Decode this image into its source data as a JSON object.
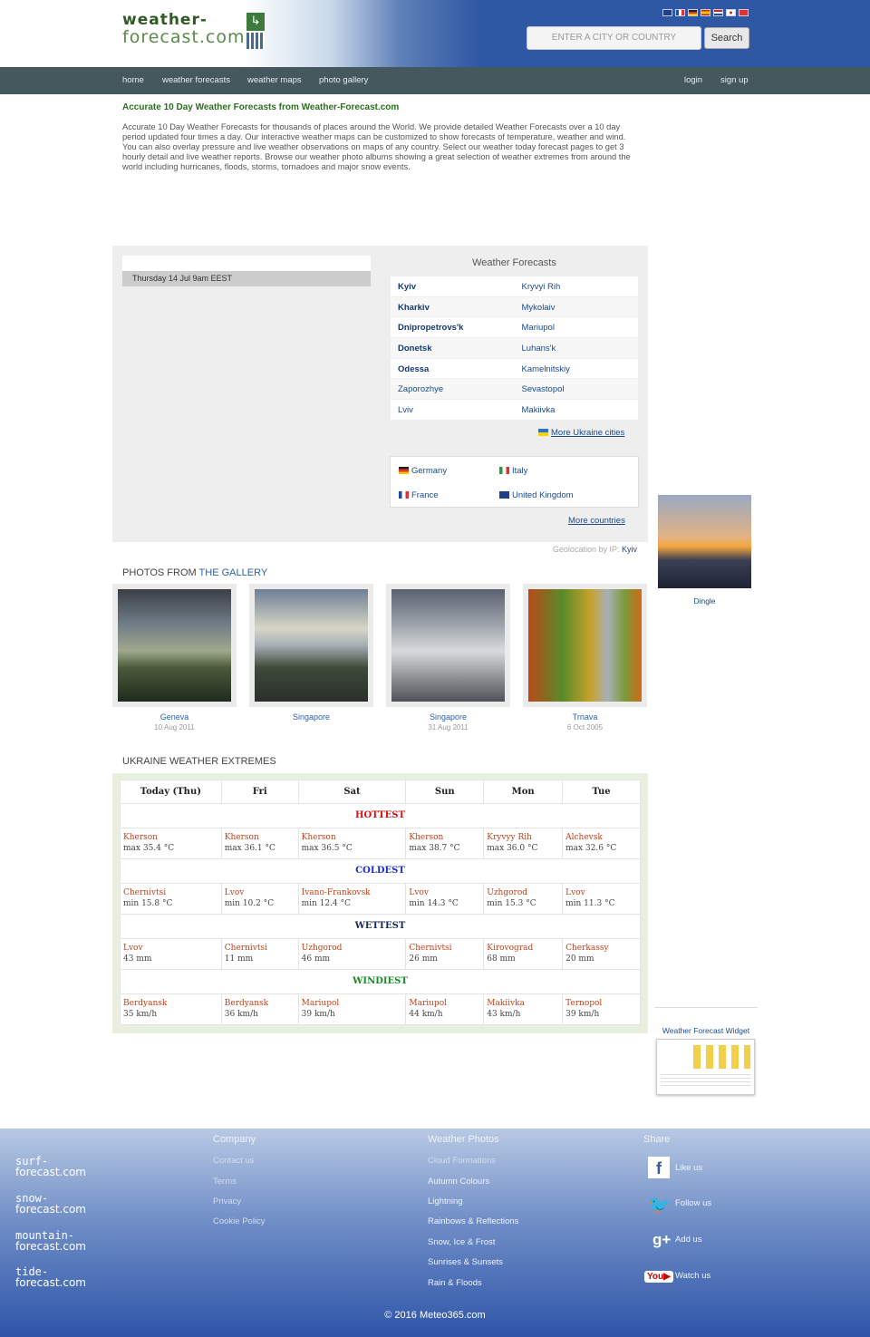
{
  "header": {
    "logo_line1": "weather-",
    "logo_line2": "forecast.com",
    "search_placeholder": "ENTER A CITY OR COUNTRY",
    "search_button": "Search",
    "flag_colors": [
      "#1f3f8a",
      "#f2f2f2",
      "#222222",
      "#d33",
      "#e06a1e",
      "#ffffff",
      "#d33"
    ]
  },
  "nav": {
    "home": "home",
    "forecasts": "weather forecasts",
    "maps": "weather maps",
    "gallery": "photo gallery",
    "login": "login",
    "signup": "sign up"
  },
  "intro": {
    "title": "Accurate 10 Day Weather Forecasts from Weather-Forecast.com",
    "text": "Accurate 10 Day Weather Forecasts for thousands of places around the World. We provide detailed Weather Forecasts over a 10 day period updated four times a day. Our interactive weather maps can be customized to show forecasts of temperature, weather and wind. You can also overlay pressure and live weather observations on maps of any country. Select our weather today forecast pages to get 3 hourly detail and live weather reports. Browse our weather photo albums showing a great selection of weather extremes from around the world including hurricanes, floods, storms, tornadoes and major snow events."
  },
  "map": {
    "date": "Thursday 14 Jul 9am EEST"
  },
  "forecasts": {
    "title": "Weather Forecasts",
    "rows": [
      {
        "left": "Kyiv",
        "right": "Kryvyi Rih"
      },
      {
        "left": "Kharkiv",
        "right": "Mykolaiv"
      },
      {
        "left": "Dnipropetrovs'k",
        "right": "Mariupol"
      },
      {
        "left": "Donetsk",
        "right": "Luhans'k"
      },
      {
        "left": "Odessa",
        "right": "Kamelnitskiy"
      },
      {
        "left": "Zaporozhye",
        "right": "Sevastopol"
      },
      {
        "left": "Lviv",
        "right": "Makiivka"
      }
    ],
    "more_cities": "More Ukraine cities",
    "countries": [
      "Germany",
      "Italy",
      "France",
      "United Kingdom"
    ],
    "more_countries": "More countries",
    "geo_label": "Geolocation by IP:",
    "geo_city": "Kyiv"
  },
  "side_photo": {
    "caption": "Dingle"
  },
  "gallery": {
    "title_prefix": "PHOTOS FROM ",
    "title_link": "THE GALLERY",
    "photos": [
      {
        "place": "Geneva",
        "date": "10 Aug 2011"
      },
      {
        "place": "Singapore",
        "date": ""
      },
      {
        "place": "Singapore",
        "date": "31 Aug 2011"
      },
      {
        "place": "Trnava",
        "date": "6 Oct 2005"
      }
    ]
  },
  "extremes": {
    "title": "UKRAINE WEATHER EXTREMES",
    "days": [
      "Today (Thu)",
      "Fri",
      "Sat",
      "Sun",
      "Mon",
      "Tue"
    ],
    "groups": [
      {
        "label": "HOTTEST",
        "color": "#d81010",
        "cells": [
          {
            "city": "Kherson",
            "value": "max 35.4 °C"
          },
          {
            "city": "Kherson",
            "value": "max 36.1 °C"
          },
          {
            "city": "Kherson",
            "value": "max 36.5 °C"
          },
          {
            "city": "Kherson",
            "value": "max 38.7 °C"
          },
          {
            "city": "Kryvyy Rih",
            "value": "max 36.0 °C"
          },
          {
            "city": "Alchevsk",
            "value": "max 32.6 °C"
          }
        ]
      },
      {
        "label": "COLDEST",
        "color": "#1a2fd0",
        "cells": [
          {
            "city": "Chernivtsi",
            "value": "min 15.8 °C"
          },
          {
            "city": "Lvov",
            "value": "min 10.2 °C"
          },
          {
            "city": "Ivano-Frankovsk",
            "value": "min 12.4 °C"
          },
          {
            "city": "Lvov",
            "value": "min 14.3 °C"
          },
          {
            "city": "Uzhgorod",
            "value": "min 15.3 °C"
          },
          {
            "city": "Lvov",
            "value": "min 11.3 °C"
          }
        ]
      },
      {
        "label": "WETTEST",
        "color": "#1b2a55",
        "cells": [
          {
            "city": "Lvov",
            "value": "43 mm"
          },
          {
            "city": "Chernivtsi",
            "value": "11 mm"
          },
          {
            "city": "Uzhgorod",
            "value": "46 mm"
          },
          {
            "city": "Chernivtsi",
            "value": "26 mm"
          },
          {
            "city": "Kirovograd",
            "value": "68 mm"
          },
          {
            "city": "Cherkassy",
            "value": "20 mm"
          }
        ]
      },
      {
        "label": "WINDIEST",
        "color": "#1a8a2a",
        "cells": [
          {
            "city": "Berdyansk",
            "value": "35 km/h"
          },
          {
            "city": "Berdyansk",
            "value": "36 km/h"
          },
          {
            "city": "Mariupol",
            "value": "39 km/h"
          },
          {
            "city": "Mariupol",
            "value": "44 km/h"
          },
          {
            "city": "Makiivka",
            "value": "43 km/h"
          },
          {
            "city": "Ternopol",
            "value": "39 km/h"
          }
        ]
      }
    ]
  },
  "widget": {
    "title": "Weather Forecast Widget"
  },
  "footer": {
    "logos": [
      {
        "top": "surf-",
        "bottom": "forecast.com"
      },
      {
        "top": "snow-",
        "bottom": "forecast.com"
      },
      {
        "top": "mountain-",
        "bottom": "forecast.com"
      },
      {
        "top": "tide-",
        "bottom": "forecast.com"
      }
    ],
    "company": {
      "title": "Company",
      "links": [
        "Contact us",
        "Terms",
        "Privacy",
        "Cookie Policy"
      ]
    },
    "photos": {
      "title": "Weather Photos",
      "links": [
        "Cloud Formations",
        "Autumn Colours",
        "Lightning",
        "Rainbows & Reflections",
        "Snow, Ice & Frost",
        "Sunrises & Sunsets",
        "Rain & Floods"
      ]
    },
    "share": {
      "title": "Share",
      "items": [
        "Like us",
        "Follow us",
        "Add us",
        "Watch us"
      ]
    },
    "copyright": "© 2016 Meteo365.com"
  }
}
